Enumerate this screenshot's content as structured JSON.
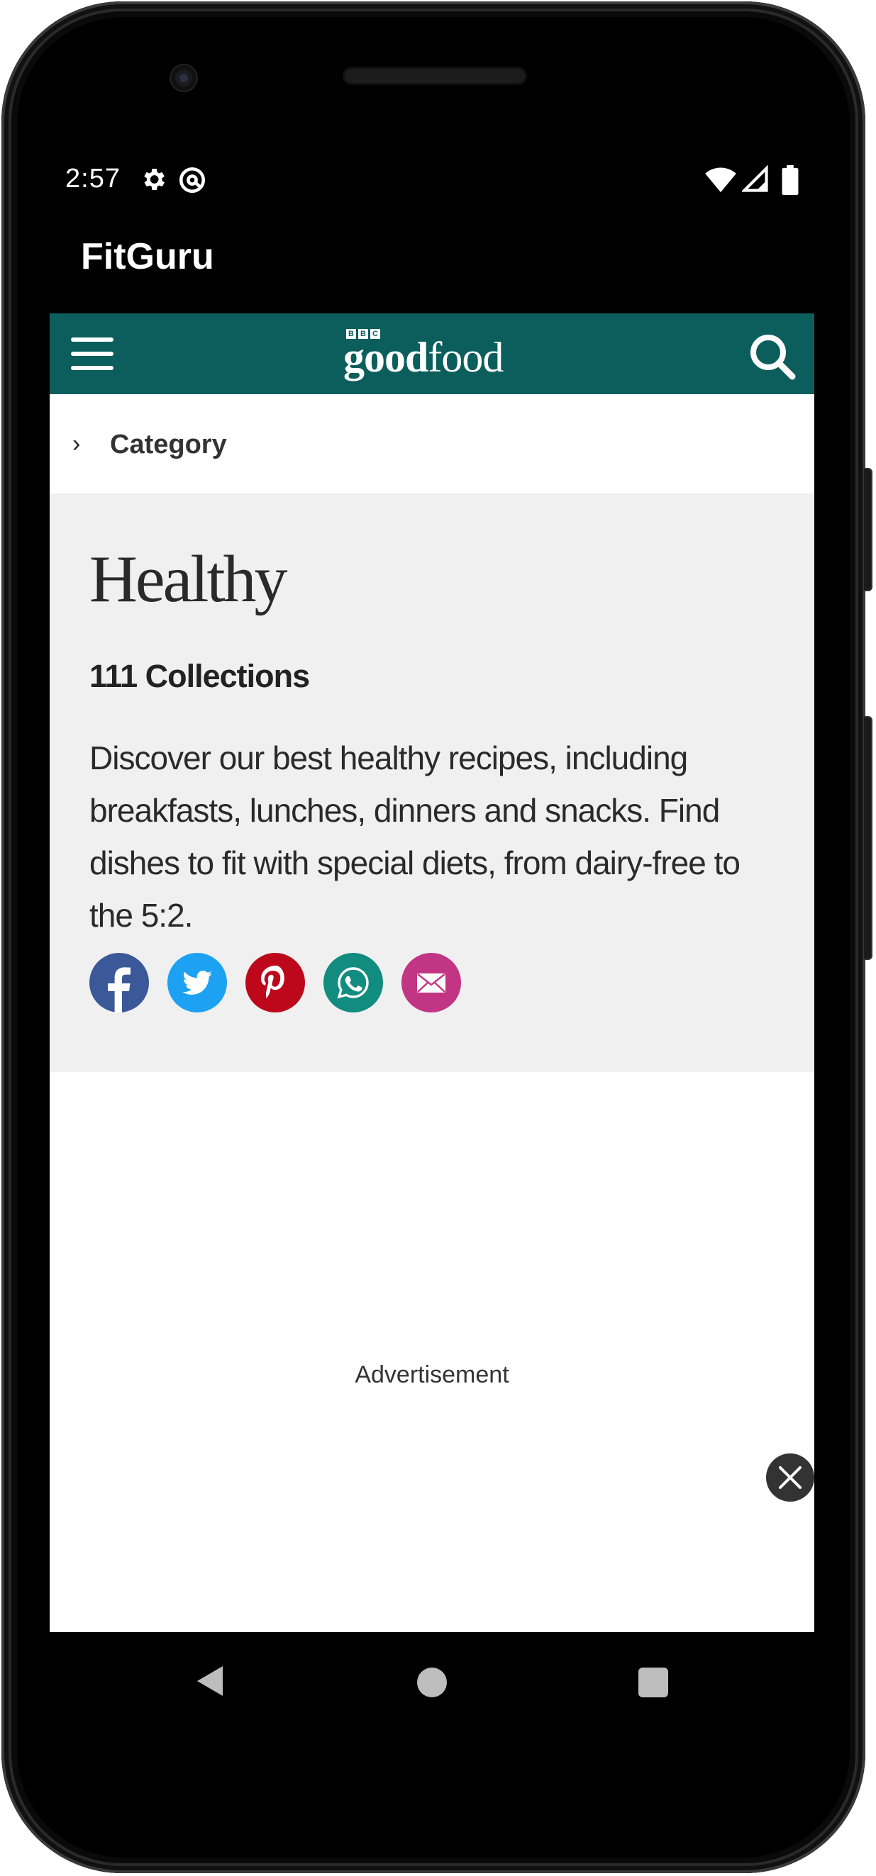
{
  "status_bar": {
    "time": "2:57",
    "icons": [
      "settings-icon",
      "at-sign-icon",
      "wifi-icon",
      "signal-icon",
      "battery-icon"
    ]
  },
  "app": {
    "title": "FitGuru"
  },
  "site_header": {
    "logo_bbc": [
      "B",
      "B",
      "C"
    ],
    "logo_good": "good",
    "logo_food": "food",
    "brand_color": "#0c5e5c",
    "icons": [
      "menu-icon",
      "search-icon"
    ]
  },
  "breadcrumb": {
    "label": "Category"
  },
  "hero": {
    "title": "Healthy",
    "count": "111 Collections",
    "description": "Discover our best healthy recipes, including breakfasts, lunches, dinners and snacks. Find dishes to fit with special diets, from dairy-free to the 5:2.",
    "share_buttons": [
      {
        "name": "facebook",
        "color": "#3b5998"
      },
      {
        "name": "twitter",
        "color": "#1da1f2"
      },
      {
        "name": "pinterest",
        "color": "#bd081c"
      },
      {
        "name": "whatsapp",
        "color": "#128c7e"
      },
      {
        "name": "email",
        "color": "#c13584"
      }
    ]
  },
  "ad": {
    "label": "Advertisement"
  },
  "nav_bar": {
    "icons": [
      "back-icon",
      "home-icon",
      "recents-icon"
    ]
  }
}
